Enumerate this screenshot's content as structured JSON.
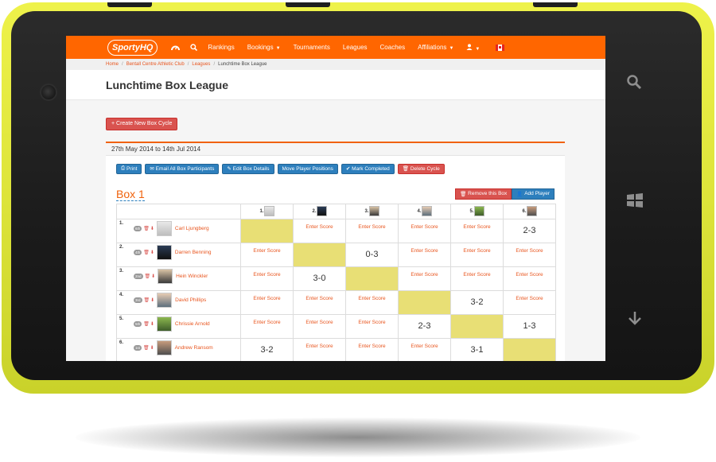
{
  "nav": {
    "logo": "SportyHQ",
    "items": [
      "Rankings",
      "Bookings",
      "Tournaments",
      "Leagues",
      "Coaches",
      "Affiliations"
    ]
  },
  "breadcrumb": [
    "Home",
    "Bentall Centre Athletic Club",
    "Leagues",
    "Lunchtime Box League"
  ],
  "page_title": "Lunchtime Box League",
  "create_button": "+ Create New Box Cycle",
  "cycle": {
    "date_range": "27th May 2014 to 14th Jul 2014",
    "actions": [
      "Print",
      "Email All Box Participants",
      "Edit Box Details",
      "Move Player Positions",
      "Mark Completed",
      "Delete Cycle"
    ]
  },
  "box": {
    "title": "Box 1",
    "remove_label": "Remove this Box",
    "add_label": "Add Player",
    "col_headers": [
      "1.",
      "2.",
      "3.",
      "4.",
      "5.",
      "6."
    ],
    "players": [
      {
        "rank": "1.",
        "badge": "6th",
        "name": "Carl Ljungberg",
        "cells": [
          "self",
          "Enter Score",
          "Enter Score",
          "Enter Score",
          "Enter Score",
          "2-3"
        ]
      },
      {
        "rank": "2.",
        "badge": "4th",
        "name": "Darren Benning",
        "cells": [
          "Enter Score",
          "self",
          "0-3",
          "Enter Score",
          "Enter Score",
          "Enter Score"
        ]
      },
      {
        "rank": "3.",
        "badge": "2nd",
        "name": "Hein Winckler",
        "cells": [
          "Enter Score",
          "3-0",
          "self",
          "Enter Score",
          "Enter Score",
          "Enter Score"
        ]
      },
      {
        "rank": "4.",
        "badge": "3rd",
        "name": "David Phillips",
        "cells": [
          "Enter Score",
          "Enter Score",
          "Enter Score",
          "self",
          "3-2",
          "Enter Score"
        ]
      },
      {
        "rank": "5.",
        "badge": "5th",
        "name": "Chrissie Arnold",
        "cells": [
          "Enter Score",
          "Enter Score",
          "Enter Score",
          "2-3",
          "self",
          "1-3"
        ]
      },
      {
        "rank": "6.",
        "badge": "1st",
        "name": "Andrew Ransom",
        "cells": [
          "3-2",
          "Enter Score",
          "Enter Score",
          "Enter Score",
          "3-1",
          "self"
        ]
      }
    ]
  },
  "colors": {
    "brand": "#ff6600",
    "highlight": "#e8df75",
    "phone": "#dde43a",
    "button_blue": "#2d7fbd",
    "button_red": "#d9534f"
  },
  "icons": [
    "dashboard-icon",
    "search-icon",
    "user-icon",
    "canada-flag-icon",
    "camera-icon",
    "search-hw-icon",
    "windows-icon",
    "back-arrow-icon"
  ]
}
